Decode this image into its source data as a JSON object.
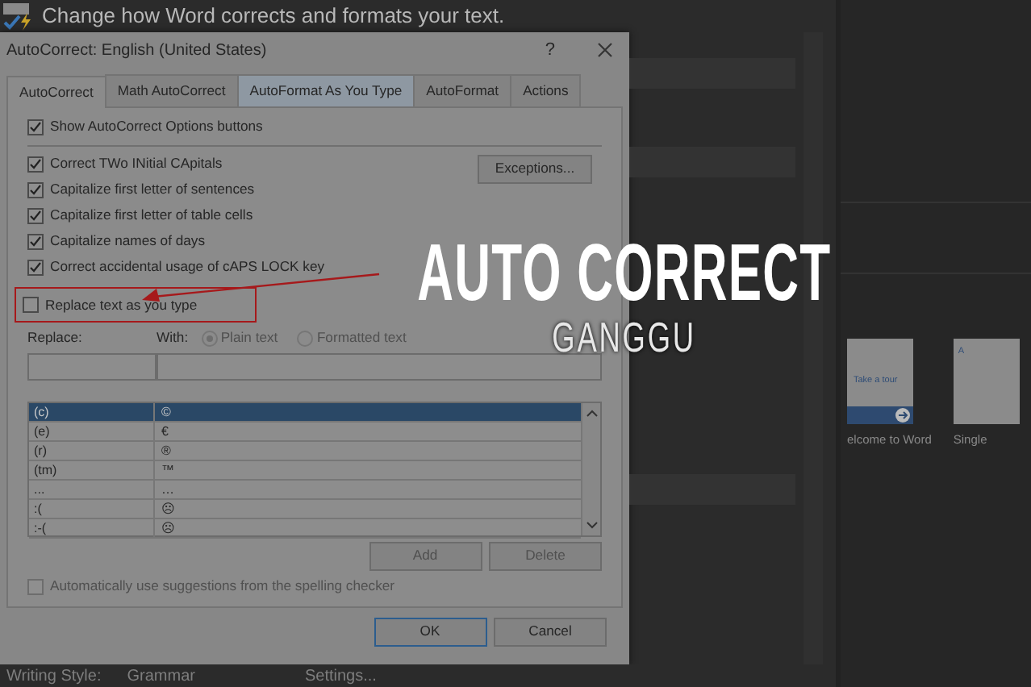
{
  "header": {
    "text": "Change how Word corrects and formats your text."
  },
  "dialog": {
    "title": "AutoCorrect: English (United States)",
    "help": "?",
    "tabs": [
      {
        "label": "AutoCorrect",
        "selected": true,
        "hover": false
      },
      {
        "label": "Math AutoCorrect",
        "selected": false,
        "hover": false
      },
      {
        "label": "AutoFormat As You Type",
        "selected": false,
        "hover": true
      },
      {
        "label": "AutoFormat",
        "selected": false,
        "hover": false
      },
      {
        "label": "Actions",
        "selected": false,
        "hover": false
      }
    ],
    "show_options": {
      "label": "Show AutoCorrect Options buttons",
      "checked": true
    },
    "options": [
      {
        "label": "Correct TWo INitial CApitals",
        "checked": true
      },
      {
        "label": "Capitalize first letter of sentences",
        "checked": true
      },
      {
        "label": "Capitalize first letter of table cells",
        "checked": true
      },
      {
        "label": "Capitalize names of days",
        "checked": true
      },
      {
        "label": "Correct accidental usage of cAPS LOCK key",
        "checked": true
      }
    ],
    "exceptions_button": "Exceptions...",
    "replace_option": {
      "label": "Replace text as you type",
      "checked": false,
      "highlighted": true
    },
    "replace_label": "Replace:",
    "with_label": "With:",
    "radios": [
      {
        "label": "Plain text",
        "selected": true
      },
      {
        "label": "Formatted text",
        "selected": false
      }
    ],
    "entries": [
      {
        "replace": "(c)",
        "with": "©",
        "selected": true
      },
      {
        "replace": "(e)",
        "with": "€",
        "selected": false
      },
      {
        "replace": "(r)",
        "with": "®",
        "selected": false
      },
      {
        "replace": "(tm)",
        "with": "™",
        "selected": false
      },
      {
        "replace": "...",
        "with": "…",
        "selected": false
      },
      {
        "replace": ":(",
        "with": "☹",
        "selected": false
      },
      {
        "replace": ":-(",
        "with": "☹",
        "selected": false
      }
    ],
    "action_buttons": [
      {
        "label": "Add",
        "disabled": true
      },
      {
        "label": "Delete",
        "disabled": true
      }
    ],
    "spelling_option": {
      "label": "Automatically use suggestions from the spelling checker",
      "checked": false,
      "disabled": true
    },
    "footer_buttons": [
      {
        "label": "OK",
        "default": true
      },
      {
        "label": "Cancel",
        "default": false
      }
    ]
  },
  "bottom_bar": {
    "label": "Writing Style:",
    "value": "Grammar",
    "button": "Settings..."
  },
  "templates": [
    {
      "card_text": "Take a tour",
      "caption": "elcome to Word"
    },
    {
      "card_text": "A",
      "caption": "Single"
    }
  ],
  "overlay": {
    "title": "AUTO CORRECT",
    "subtitle": "GANGGU"
  }
}
